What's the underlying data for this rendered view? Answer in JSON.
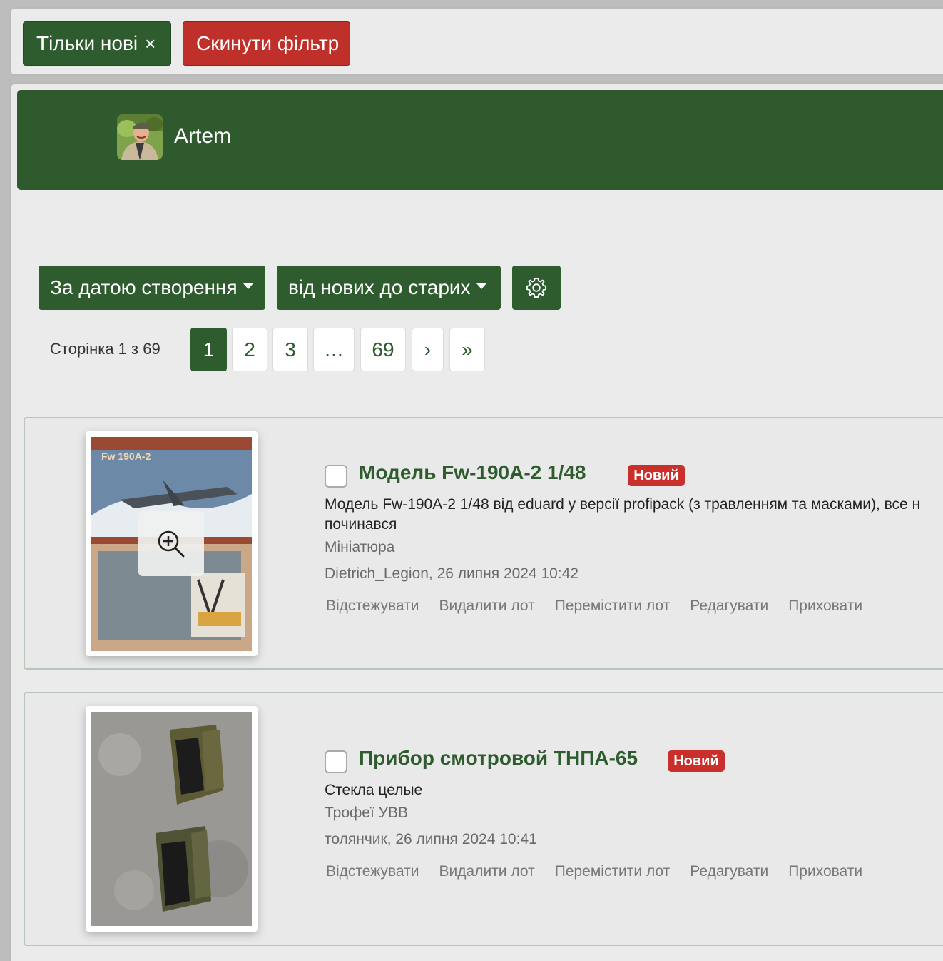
{
  "filters": {
    "only_new_label": "Тільки нові",
    "close_glyph": "×",
    "reset_label": "Скинути фільтр"
  },
  "user": {
    "name": "Artem"
  },
  "sort": {
    "field_label": "За датою створення",
    "order_label": "від нових до старих"
  },
  "pagination": {
    "info": "Сторінка 1 з 69",
    "pages": [
      "1",
      "2",
      "3",
      "…",
      "69"
    ],
    "current": "1",
    "next": "›",
    "last": "»"
  },
  "lots": [
    {
      "title": "Модель Fw-190A-2 1/48",
      "badge": "Новий",
      "description_line1": "Модель Fw-190A-2 1/48 від eduard у версії profipack (з травленням та масками), все н",
      "description_line2": "починався",
      "image_text": "Fw 190A-2",
      "category": "Мініатюра",
      "author_date": "Dietrich_Legion, 26 липня 2024 10:42"
    },
    {
      "title": "Прибор смотровой ТНПА-65",
      "badge": "Новий",
      "description_line1": "Стекла целые",
      "category": "Трофеї УВВ",
      "author_date": "толянчик, 26 липня 2024 10:41"
    }
  ],
  "actions": {
    "track": "Відстежувати",
    "delete": "Видалити лот",
    "move": "Перемістити лот",
    "edit": "Редагувати",
    "hide": "Приховати"
  },
  "colors": {
    "primary_green": "#2e5c2e",
    "banner_green": "#2e5a2e",
    "danger_red": "#c0302b",
    "badge_red": "#c9302c"
  }
}
